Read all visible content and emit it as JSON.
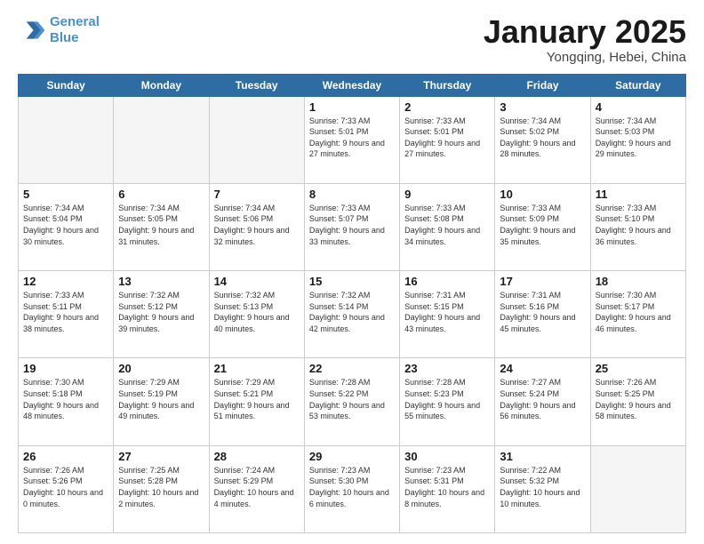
{
  "logo": {
    "line1": "General",
    "line2": "Blue"
  },
  "title": "January 2025",
  "subtitle": "Yongqing, Hebei, China",
  "weekdays": [
    "Sunday",
    "Monday",
    "Tuesday",
    "Wednesday",
    "Thursday",
    "Friday",
    "Saturday"
  ],
  "weeks": [
    [
      {
        "day": "",
        "empty": true
      },
      {
        "day": "",
        "empty": true
      },
      {
        "day": "",
        "empty": true
      },
      {
        "day": "1",
        "sunrise": "7:33 AM",
        "sunset": "5:01 PM",
        "daylight": "9 hours and 27 minutes."
      },
      {
        "day": "2",
        "sunrise": "7:33 AM",
        "sunset": "5:01 PM",
        "daylight": "9 hours and 27 minutes."
      },
      {
        "day": "3",
        "sunrise": "7:34 AM",
        "sunset": "5:02 PM",
        "daylight": "9 hours and 28 minutes."
      },
      {
        "day": "4",
        "sunrise": "7:34 AM",
        "sunset": "5:03 PM",
        "daylight": "9 hours and 29 minutes."
      }
    ],
    [
      {
        "day": "5",
        "sunrise": "7:34 AM",
        "sunset": "5:04 PM",
        "daylight": "9 hours and 30 minutes."
      },
      {
        "day": "6",
        "sunrise": "7:34 AM",
        "sunset": "5:05 PM",
        "daylight": "9 hours and 31 minutes."
      },
      {
        "day": "7",
        "sunrise": "7:34 AM",
        "sunset": "5:06 PM",
        "daylight": "9 hours and 32 minutes."
      },
      {
        "day": "8",
        "sunrise": "7:33 AM",
        "sunset": "5:07 PM",
        "daylight": "9 hours and 33 minutes."
      },
      {
        "day": "9",
        "sunrise": "7:33 AM",
        "sunset": "5:08 PM",
        "daylight": "9 hours and 34 minutes."
      },
      {
        "day": "10",
        "sunrise": "7:33 AM",
        "sunset": "5:09 PM",
        "daylight": "9 hours and 35 minutes."
      },
      {
        "day": "11",
        "sunrise": "7:33 AM",
        "sunset": "5:10 PM",
        "daylight": "9 hours and 36 minutes."
      }
    ],
    [
      {
        "day": "12",
        "sunrise": "7:33 AM",
        "sunset": "5:11 PM",
        "daylight": "9 hours and 38 minutes."
      },
      {
        "day": "13",
        "sunrise": "7:32 AM",
        "sunset": "5:12 PM",
        "daylight": "9 hours and 39 minutes."
      },
      {
        "day": "14",
        "sunrise": "7:32 AM",
        "sunset": "5:13 PM",
        "daylight": "9 hours and 40 minutes."
      },
      {
        "day": "15",
        "sunrise": "7:32 AM",
        "sunset": "5:14 PM",
        "daylight": "9 hours and 42 minutes."
      },
      {
        "day": "16",
        "sunrise": "7:31 AM",
        "sunset": "5:15 PM",
        "daylight": "9 hours and 43 minutes."
      },
      {
        "day": "17",
        "sunrise": "7:31 AM",
        "sunset": "5:16 PM",
        "daylight": "9 hours and 45 minutes."
      },
      {
        "day": "18",
        "sunrise": "7:30 AM",
        "sunset": "5:17 PM",
        "daylight": "9 hours and 46 minutes."
      }
    ],
    [
      {
        "day": "19",
        "sunrise": "7:30 AM",
        "sunset": "5:18 PM",
        "daylight": "9 hours and 48 minutes."
      },
      {
        "day": "20",
        "sunrise": "7:29 AM",
        "sunset": "5:19 PM",
        "daylight": "9 hours and 49 minutes."
      },
      {
        "day": "21",
        "sunrise": "7:29 AM",
        "sunset": "5:21 PM",
        "daylight": "9 hours and 51 minutes."
      },
      {
        "day": "22",
        "sunrise": "7:28 AM",
        "sunset": "5:22 PM",
        "daylight": "9 hours and 53 minutes."
      },
      {
        "day": "23",
        "sunrise": "7:28 AM",
        "sunset": "5:23 PM",
        "daylight": "9 hours and 55 minutes."
      },
      {
        "day": "24",
        "sunrise": "7:27 AM",
        "sunset": "5:24 PM",
        "daylight": "9 hours and 56 minutes."
      },
      {
        "day": "25",
        "sunrise": "7:26 AM",
        "sunset": "5:25 PM",
        "daylight": "9 hours and 58 minutes."
      }
    ],
    [
      {
        "day": "26",
        "sunrise": "7:26 AM",
        "sunset": "5:26 PM",
        "daylight": "10 hours and 0 minutes."
      },
      {
        "day": "27",
        "sunrise": "7:25 AM",
        "sunset": "5:28 PM",
        "daylight": "10 hours and 2 minutes."
      },
      {
        "day": "28",
        "sunrise": "7:24 AM",
        "sunset": "5:29 PM",
        "daylight": "10 hours and 4 minutes."
      },
      {
        "day": "29",
        "sunrise": "7:23 AM",
        "sunset": "5:30 PM",
        "daylight": "10 hours and 6 minutes."
      },
      {
        "day": "30",
        "sunrise": "7:23 AM",
        "sunset": "5:31 PM",
        "daylight": "10 hours and 8 minutes."
      },
      {
        "day": "31",
        "sunrise": "7:22 AM",
        "sunset": "5:32 PM",
        "daylight": "10 hours and 10 minutes."
      },
      {
        "day": "",
        "empty": true
      }
    ]
  ]
}
